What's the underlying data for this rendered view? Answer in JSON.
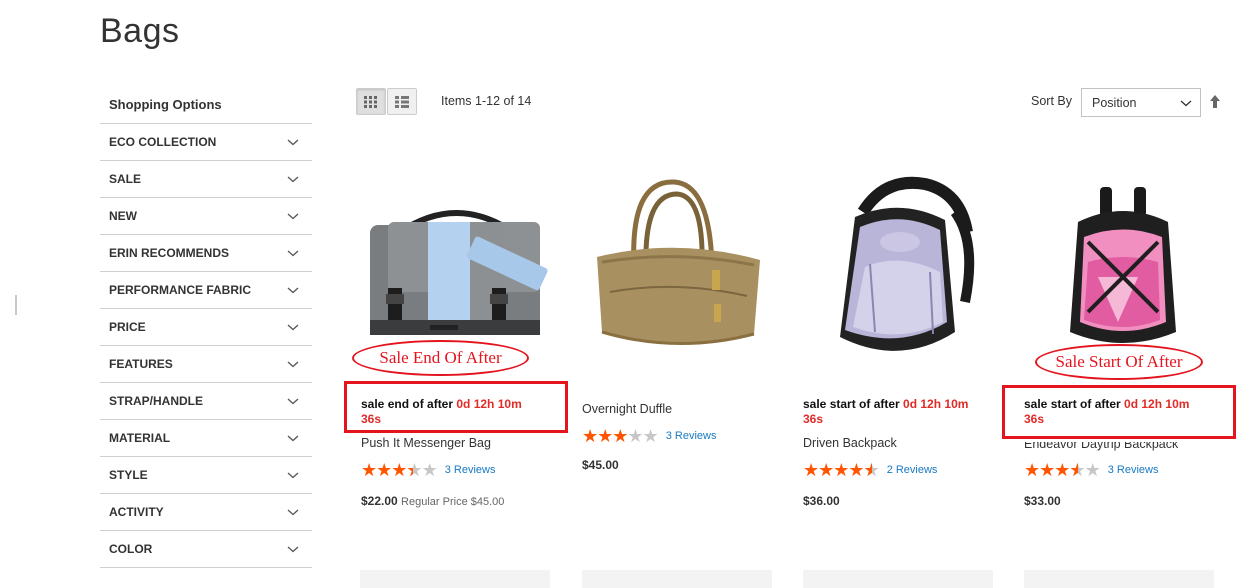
{
  "page": {
    "title": "Bags"
  },
  "sidebar": {
    "title": "Shopping Options",
    "filters": [
      {
        "label": "ECO COLLECTION"
      },
      {
        "label": "SALE"
      },
      {
        "label": "NEW"
      },
      {
        "label": "ERIN RECOMMENDS"
      },
      {
        "label": "PERFORMANCE FABRIC"
      },
      {
        "label": "PRICE"
      },
      {
        "label": "FEATURES"
      },
      {
        "label": "STRAP/HANDLE"
      },
      {
        "label": "MATERIAL"
      },
      {
        "label": "STYLE"
      },
      {
        "label": "ACTIVITY"
      },
      {
        "label": "COLOR"
      }
    ]
  },
  "toolbar": {
    "view_modes": [
      "grid-icon",
      "list-icon"
    ],
    "items_count": "Items 1-12 of 14",
    "sort_label": "Sort By",
    "sort_value": "Position",
    "sort_direction_icon": "arrow-up-icon"
  },
  "products": [
    {
      "timer_prefix": "sale end of after",
      "timer_time_line1": "0d 12h 10m",
      "timer_time_line2": "36s",
      "name": "Push It Messenger Bag",
      "rating_fraction": 0.7,
      "reviews": "3 Reviews",
      "price": "$22.00",
      "regular_price": "Regular Price $45.00",
      "image_icon": "messenger-bag-icon"
    },
    {
      "timer_prefix": "",
      "timer_time_line1": "",
      "timer_time_line2": "",
      "name": "Overnight Duffle",
      "rating_fraction": 0.6,
      "reviews": "3 Reviews",
      "price": "$45.00",
      "regular_price": "",
      "image_icon": "duffle-bag-icon"
    },
    {
      "timer_prefix": "sale start of after",
      "timer_time_line1": "0d 12h 10m",
      "timer_time_line2": "36s",
      "name": "Driven Backpack",
      "rating_fraction": 0.9,
      "reviews": "2 Reviews",
      "price": "$36.00",
      "regular_price": "",
      "image_icon": "backpack-purple-icon"
    },
    {
      "timer_prefix": "sale start of after",
      "timer_time_line1": "0d 12h 10m",
      "timer_time_line2": "36s",
      "name": "Endeavor Daytrip Backpack",
      "rating_fraction": 0.7,
      "reviews": "3 Reviews",
      "price": "$33.00",
      "regular_price": "",
      "image_icon": "backpack-pink-icon"
    }
  ],
  "annotations": {
    "oval_end": "Sale End Of After",
    "oval_start": "Sale Start Of After"
  },
  "colors": {
    "accent_red": "#e4141e",
    "timer_red": "#e02b27",
    "star": "#ff5501",
    "link": "#1979c3"
  }
}
